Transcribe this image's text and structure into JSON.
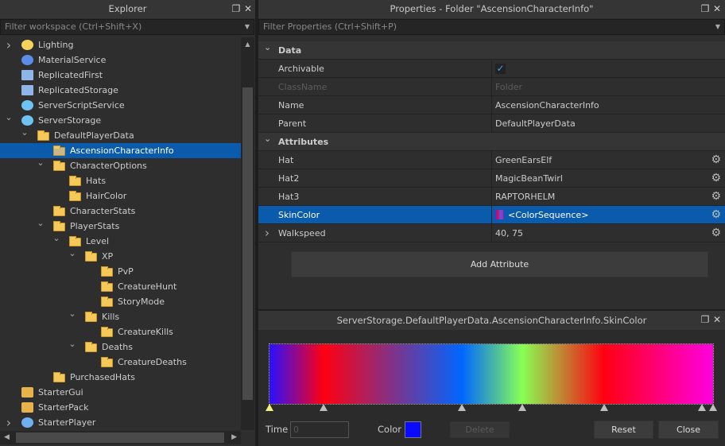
{
  "explorer": {
    "title": "Explorer",
    "filter_placeholder": "Filter workspace (Ctrl+Shift+X)",
    "items": [
      {
        "label": "Lighting",
        "level": 0,
        "chev": "right",
        "icon": "lighting-icon"
      },
      {
        "label": "MaterialService",
        "level": 0,
        "chev": "",
        "icon": "material-service-icon"
      },
      {
        "label": "ReplicatedFirst",
        "level": 0,
        "chev": "",
        "icon": "replicated-first-icon"
      },
      {
        "label": "ReplicatedStorage",
        "level": 0,
        "chev": "",
        "icon": "replicated-storage-icon"
      },
      {
        "label": "ServerScriptService",
        "level": 0,
        "chev": "",
        "icon": "server-script-service-icon"
      },
      {
        "label": "ServerStorage",
        "level": 0,
        "chev": "down",
        "icon": "server-storage-icon"
      },
      {
        "label": "DefaultPlayerData",
        "level": 1,
        "chev": "down",
        "icon": "folder-icon"
      },
      {
        "label": "AscensionCharacterInfo",
        "level": 2,
        "chev": "",
        "icon": "folder-icon",
        "selected": true
      },
      {
        "label": "CharacterOptions",
        "level": 2,
        "chev": "down",
        "icon": "folder-icon"
      },
      {
        "label": "Hats",
        "level": 3,
        "chev": "",
        "icon": "folder-icon"
      },
      {
        "label": "HairColor",
        "level": 3,
        "chev": "",
        "icon": "folder-icon"
      },
      {
        "label": "CharacterStats",
        "level": 2,
        "chev": "",
        "icon": "folder-icon"
      },
      {
        "label": "PlayerStats",
        "level": 2,
        "chev": "down",
        "icon": "folder-icon"
      },
      {
        "label": "Level",
        "level": 3,
        "chev": "down",
        "icon": "folder-icon"
      },
      {
        "label": "XP",
        "level": 4,
        "chev": "down",
        "icon": "folder-icon"
      },
      {
        "label": "PvP",
        "level": 5,
        "chev": "",
        "icon": "folder-icon"
      },
      {
        "label": "CreatureHunt",
        "level": 5,
        "chev": "",
        "icon": "folder-icon"
      },
      {
        "label": "StoryMode",
        "level": 5,
        "chev": "",
        "icon": "folder-icon"
      },
      {
        "label": "Kills",
        "level": 4,
        "chev": "down",
        "icon": "folder-icon"
      },
      {
        "label": "CreatureKills",
        "level": 5,
        "chev": "",
        "icon": "folder-icon"
      },
      {
        "label": "Deaths",
        "level": 4,
        "chev": "down",
        "icon": "folder-icon"
      },
      {
        "label": "CreatureDeaths",
        "level": 5,
        "chev": "",
        "icon": "folder-icon"
      },
      {
        "label": "PurchasedHats",
        "level": 2,
        "chev": "",
        "icon": "folder-icon"
      },
      {
        "label": "StarterGui",
        "level": 0,
        "chev": "",
        "icon": "starter-gui-icon"
      },
      {
        "label": "StarterPack",
        "level": 0,
        "chev": "",
        "icon": "starter-pack-icon"
      },
      {
        "label": "StarterPlayer",
        "level": 0,
        "chev": "right",
        "icon": "starter-player-icon"
      }
    ]
  },
  "properties": {
    "title": "Properties - Folder \"AscensionCharacterInfo\"",
    "filter_placeholder": "Filter Properties (Ctrl+Shift+P)",
    "sections": {
      "data": "Data",
      "attributes": "Attributes"
    },
    "data_rows": [
      {
        "name": "Archivable",
        "value": "",
        "checkbox": true
      },
      {
        "name": "ClassName",
        "value": "Folder",
        "disabled": true
      },
      {
        "name": "Name",
        "value": "AscensionCharacterInfo"
      },
      {
        "name": "Parent",
        "value": "DefaultPlayerData"
      }
    ],
    "attribute_rows": [
      {
        "name": "Hat",
        "value": "GreenEarsElf"
      },
      {
        "name": "Hat2",
        "value": "MagicBeanTwirl"
      },
      {
        "name": "Hat3",
        "value": "RAPTORHELM"
      },
      {
        "name": "SkinColor",
        "value": "<ColorSequence>",
        "selected": true
      },
      {
        "name": "Walkspeed",
        "value": "40, 75",
        "expandable": true
      }
    ],
    "add_attribute": "Add Attribute"
  },
  "color_editor": {
    "title": "ServerStorage.DefaultPlayerData.AscensionCharacterInfo.SkinColor",
    "keypoints": [
      {
        "time": 0,
        "color": "#2a10ff"
      },
      {
        "time": 0.122,
        "color": "#ff0010"
      },
      {
        "time": 0.434,
        "color": "#0066ff"
      },
      {
        "time": 0.57,
        "color": "#88ff55"
      },
      {
        "time": 0.754,
        "color": "#ff0010"
      },
      {
        "time": 0.975,
        "color": "#ff00cc"
      },
      {
        "time": 1,
        "color": "#ff00dd"
      }
    ],
    "selected_keypoint": 0,
    "time_label": "Time",
    "time_value": "0",
    "color_label": "Color",
    "color_value": "#0a0aff",
    "delete": "Delete",
    "reset": "Reset",
    "close": "Close"
  }
}
